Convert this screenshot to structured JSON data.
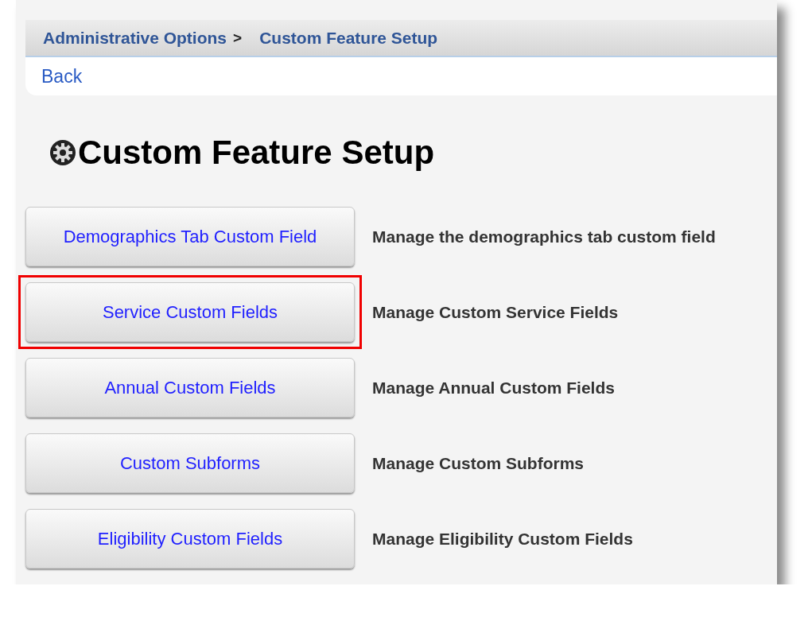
{
  "breadcrumb": [
    {
      "label": "Administrative Options",
      "separator": ">"
    },
    {
      "label": "Custom Feature Setup"
    }
  ],
  "back_link": "Back",
  "title": "Custom Feature Setup",
  "features": [
    {
      "button": "Demographics Tab Custom Field",
      "description": "Manage the demographics tab custom field",
      "highlighted": false
    },
    {
      "button": "Service Custom Fields",
      "description": "Manage Custom Service Fields",
      "highlighted": true
    },
    {
      "button": "Annual Custom Fields",
      "description": "Manage Annual Custom Fields",
      "highlighted": false
    },
    {
      "button": "Custom Subforms",
      "description": "Manage Custom Subforms",
      "highlighted": false
    },
    {
      "button": "Eligibility Custom Fields",
      "description": "Manage Eligibility Custom Fields",
      "highlighted": false
    }
  ]
}
